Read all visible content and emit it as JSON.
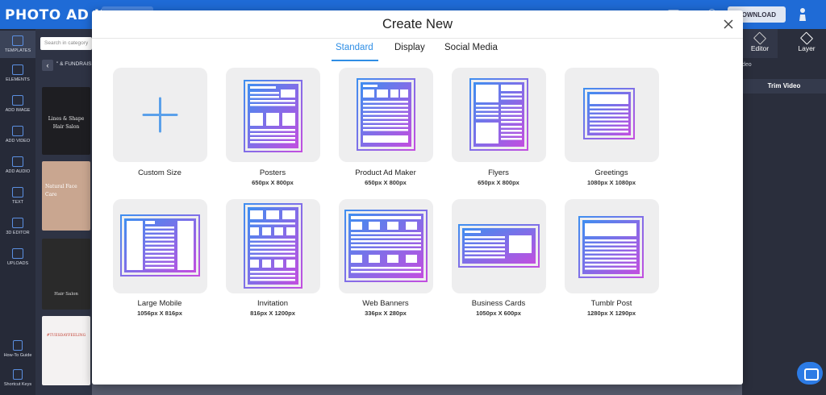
{
  "app": {
    "logo_text": "PHOTO AD KING",
    "download_label": "DOWNLOAD"
  },
  "sidebar": {
    "items": [
      {
        "label": "TEMPLATES",
        "icon": "templates-icon"
      },
      {
        "label": "ELEMENTS",
        "icon": "elements-icon"
      },
      {
        "label": "ADD IMAGE",
        "icon": "image-icon"
      },
      {
        "label": "ADD VIDEO",
        "icon": "video-icon"
      },
      {
        "label": "ADD AUDIO",
        "icon": "audio-icon"
      },
      {
        "label": "TEXT",
        "icon": "text-icon"
      },
      {
        "label": "3D EDITOR",
        "icon": "cube-icon"
      },
      {
        "label": "UPLOADS",
        "icon": "upload-icon"
      }
    ],
    "bottom": [
      {
        "label": "How-To Guide",
        "icon": "help-icon"
      },
      {
        "label": "Shortcut Keys",
        "icon": "keyboard-icon"
      }
    ]
  },
  "panel": {
    "search_placeholder": "Search in category",
    "breadcrumb": "\" & FUNDRAIS",
    "thumbs": [
      {
        "line1": "Lines & Shape",
        "line2": "Hair Salon"
      },
      {
        "line1": "Natural Face",
        "line2": "Care"
      },
      {
        "line1": "Hair Salon",
        "line2": ""
      },
      {
        "line1": "#TUESDAYFEELING",
        "line2": ""
      }
    ]
  },
  "right_panel": {
    "tabs": [
      {
        "label": "Editor"
      },
      {
        "label": "Layer"
      }
    ],
    "video_label": "deo",
    "trim_label": "Trim Video"
  },
  "modal": {
    "title": "Create New",
    "tabs": [
      {
        "label": "Standard",
        "active": true
      },
      {
        "label": "Display",
        "active": false
      },
      {
        "label": "Social Media",
        "active": false
      }
    ],
    "cards": [
      {
        "label": "Custom Size",
        "dim": "",
        "icon": "plus-icon"
      },
      {
        "label": "Posters",
        "dim": "650px X 800px",
        "icon": "poster-icon"
      },
      {
        "label": "Product Ad Maker",
        "dim": "650px X 800px",
        "icon": "product-ad-icon"
      },
      {
        "label": "Flyers",
        "dim": "650px X 800px",
        "icon": "flyer-icon"
      },
      {
        "label": "Greetings",
        "dim": "1080px X 1080px",
        "icon": "greeting-icon"
      },
      {
        "label": "Large Mobile",
        "dim": "1056px X 816px",
        "icon": "large-mobile-icon"
      },
      {
        "label": "Invitation",
        "dim": "816px X 1200px",
        "icon": "invitation-icon"
      },
      {
        "label": "Web Banners",
        "dim": "336px X 280px",
        "icon": "web-banner-icon"
      },
      {
        "label": "Business Cards",
        "dim": "1050px X 600px",
        "icon": "business-card-icon"
      },
      {
        "label": "Tumblr Post",
        "dim": "1280px X 1290px",
        "icon": "tumblr-post-icon"
      }
    ]
  },
  "colors": {
    "accent": "#2f8ee5",
    "gradient_start": "#3e8ef0",
    "gradient_end": "#c24ee0",
    "card_bg": "#eeeeef",
    "topbar": "#1f6bd6"
  }
}
